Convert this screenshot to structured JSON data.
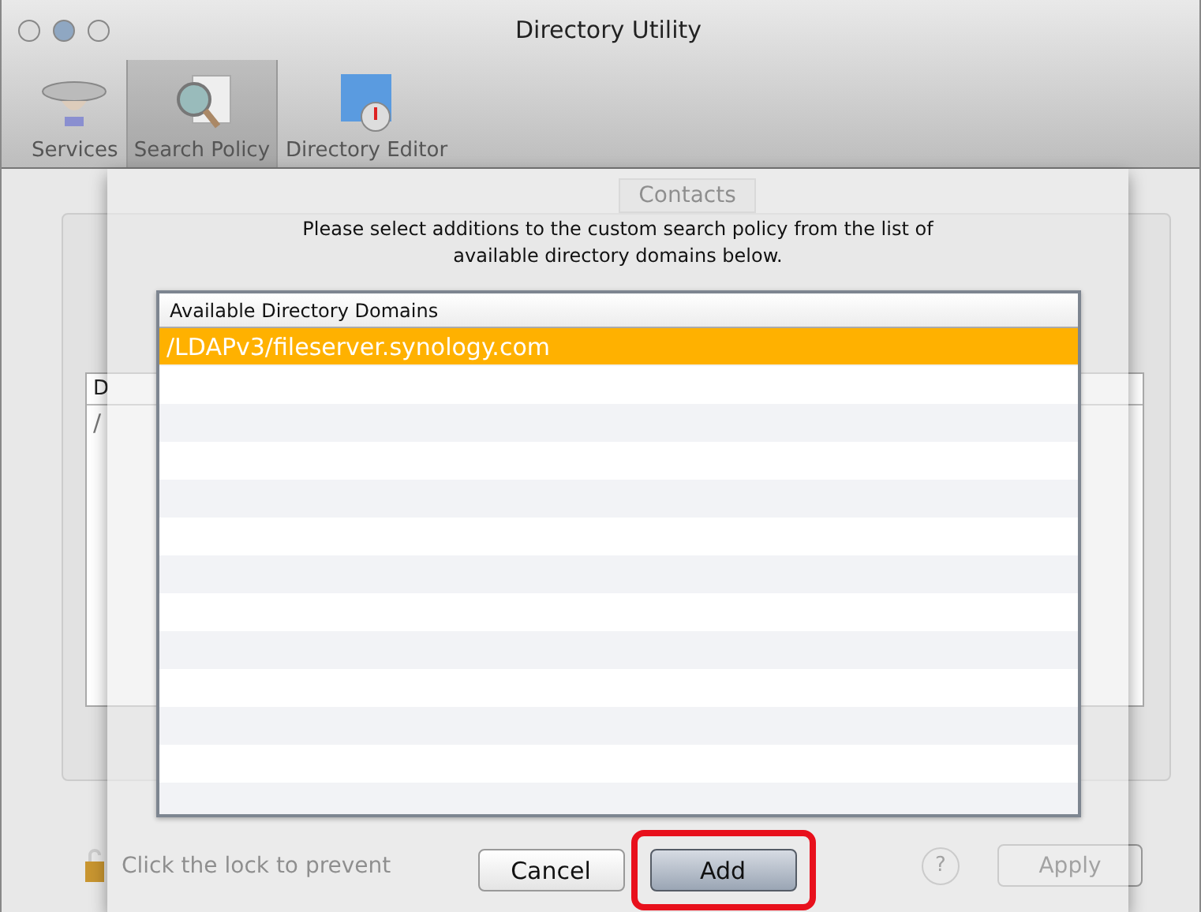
{
  "window": {
    "title": "Directory Utility"
  },
  "toolbar": [
    {
      "label": "Services",
      "selected": false,
      "kind": "services"
    },
    {
      "label": "Search Policy",
      "selected": true,
      "kind": "search"
    },
    {
      "label": "Directory Editor",
      "selected": false,
      "kind": "editor"
    }
  ],
  "background": {
    "tab": "Contacts",
    "table": {
      "column_1": "D",
      "rows": [
        "/"
      ]
    },
    "lock_text": "Click the lock to prevent",
    "help": "?",
    "apply": "Apply"
  },
  "sheet": {
    "message": "Please select additions to the custom search policy from the list of available directory domains below.",
    "list": {
      "header": "Available Directory Domains",
      "rows": [
        {
          "text": "/LDAPv3/fileserver.synology.com",
          "selected": true
        }
      ]
    },
    "buttons": [
      {
        "label": "Cancel",
        "default": false,
        "highlighted": false
      },
      {
        "label": "Add",
        "default": true,
        "highlighted": true
      }
    ]
  }
}
